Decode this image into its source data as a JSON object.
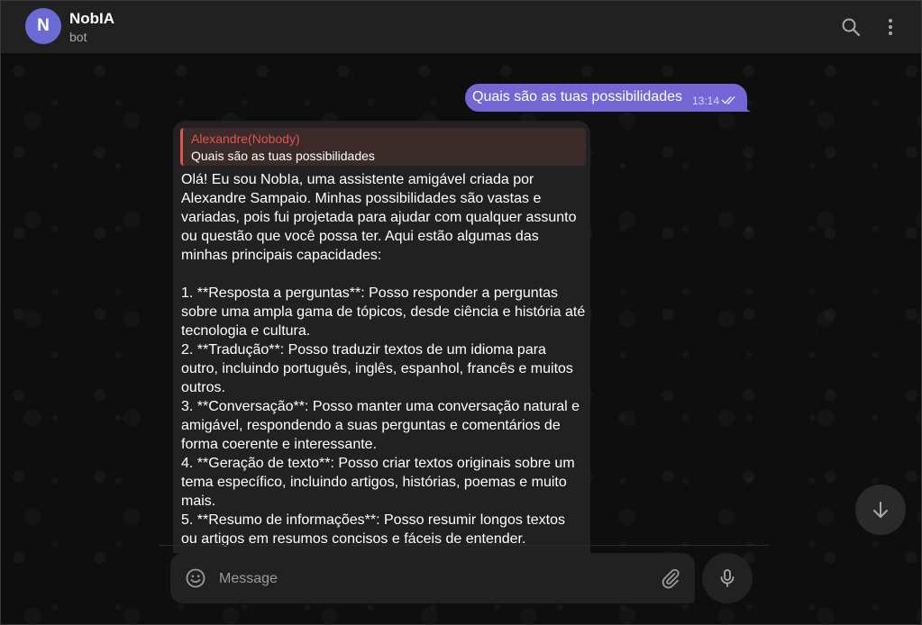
{
  "header": {
    "avatar_letter": "N",
    "chat_name": "NobIA",
    "status": "bot"
  },
  "outgoing": {
    "text": "Quais são as tuas possibilidades",
    "time": "13:14"
  },
  "incoming": {
    "reply": {
      "author": "Alexandre(Nobody)",
      "text": "Quais são as tuas possibilidades"
    },
    "lines": [
      "Olá! Eu sou NobIa, uma assistente amigável criada por",
      "Alexandre Sampaio. Minhas possibilidades são vastas e",
      "variadas, pois fui projetada para ajudar com qualquer assunto",
      "ou questão que você possa ter. Aqui estão algumas das",
      "minhas principais capacidades:",
      "",
      "1. **Resposta a perguntas**: Posso responder a perguntas",
      "sobre uma ampla gama de tópicos, desde ciência e história até",
      "tecnologia e cultura.",
      "2. **Tradução**: Posso traduzir textos de um idioma para",
      "outro, incluindo português, inglês, espanhol, francês e muitos",
      "outros.",
      "3. **Conversação**: Posso manter uma conversação natural e",
      "amigável, respondendo a suas perguntas e comentários de",
      "forma coerente e interessante.",
      "4. **Geração de texto**: Posso criar textos originais sobre um",
      "tema específico, incluindo artigos, histórias, poemas e muito",
      "mais.",
      "5. **Resumo de informações**: Posso resumir longos textos",
      "ou artigos em resumos concisos e fáceis de entender."
    ]
  },
  "composer": {
    "placeholder": "Message"
  },
  "colors": {
    "accent": "#7566d6",
    "reply_accent": "#e0544b",
    "header_bg": "#212121",
    "bubble_bg": "#212121"
  },
  "icons": {
    "search": "search-icon",
    "menu": "more-vertical-icon",
    "scroll": "arrow-down-icon",
    "emoji": "emoji-icon",
    "attach": "paperclip-icon",
    "mic": "microphone-icon",
    "read": "double-check-icon"
  }
}
